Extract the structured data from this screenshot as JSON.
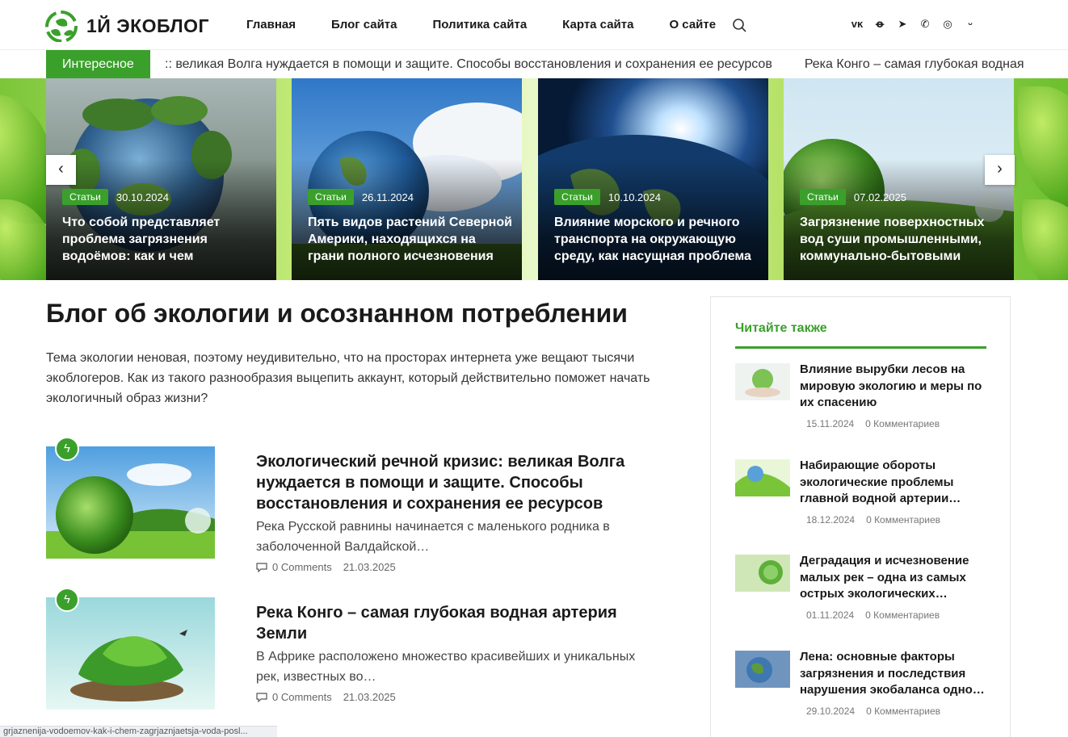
{
  "header": {
    "logo_text": "1Й ЭКОБЛОГ",
    "nav": [
      "Главная",
      "Блог сайта",
      "Политика сайта",
      "Карта сайта",
      "О сайте"
    ],
    "socials": [
      "vk-icon",
      "ok-icon",
      "telegram-icon",
      "viber-icon",
      "whatsapp-icon",
      "moimir-icon"
    ]
  },
  "ticker": {
    "label": "Интересное",
    "items": [
      ":: великая Волга нуждается в помощи и защите. Способы восстановления и сохранения ее ресурсов",
      "Река Конго – самая глубокая водная"
    ]
  },
  "slider": {
    "cards": [
      {
        "badge": "Статьи",
        "date": "30.10.2024",
        "title": "Что собой представляет проблема загрязнения водоёмов: как и чем"
      },
      {
        "badge": "Статьи",
        "date": "26.11.2024",
        "title": "Пять видов растений Северной Америки, находящихся на грани полного исчезновения"
      },
      {
        "badge": "Статьи",
        "date": "10.10.2024",
        "title": "Влияние морского и речного транспорта на окружающую среду, как насущная проблема"
      },
      {
        "badge": "Статьи",
        "date": "07.02.2025",
        "title": "Загрязнение поверхностных вод суши промышленными, коммунально-бытовыми"
      }
    ],
    "prev": "‹",
    "next": "›"
  },
  "main": {
    "title": "Блог об экологии и осознанном потреблении",
    "intro": "Тема экологии неновая, поэтому неудивительно, что на просторах интернета уже вещают тысячи экоблогеров. Как из такого разнообразия выцепить аккаунт, который действительно поможет начать экологичный образ жизни?",
    "posts": [
      {
        "title": "Экологический речной кризис: великая Волга нуждается в помощи и защите. Способы восстановления и сохранения ее ресурсов",
        "excerpt": "Река Русской равнины начинается с маленького родника в заболоченной Валдайской…",
        "comments": "0 Comments",
        "date": "21.03.2025"
      },
      {
        "title": "Река Конго – самая глубокая водная артерия Земли",
        "excerpt": "В Африке расположено множество красивейших и уникальных рек, известных во…",
        "comments": "0 Comments",
        "date": "21.03.2025"
      }
    ]
  },
  "sidebar": {
    "heading": "Читайте также",
    "items": [
      {
        "title": "Влияние вырубки лесов на мировую экологию и меры по их спасению",
        "date": "15.11.2024",
        "comments": "0 Комментариев"
      },
      {
        "title": "Набирающие обороты экологические проблемы главной водной артерии…",
        "date": "18.12.2024",
        "comments": "0 Комментариев"
      },
      {
        "title": "Деградация и исчезновение малых рек – одна из самых острых экологических…",
        "date": "01.11.2024",
        "comments": "0 Комментариев"
      },
      {
        "title": "Лена: основные факторы загрязнения и последствия нарушения экобаланса одно…",
        "date": "29.10.2024",
        "comments": "0 Комментариев"
      }
    ]
  },
  "statusbar": {
    "url": "grjaznenija-vodoemov-kak-i-chem-zagrjaznjaetsja-voda-posl..."
  },
  "colors": {
    "accent": "#3aa02b"
  }
}
